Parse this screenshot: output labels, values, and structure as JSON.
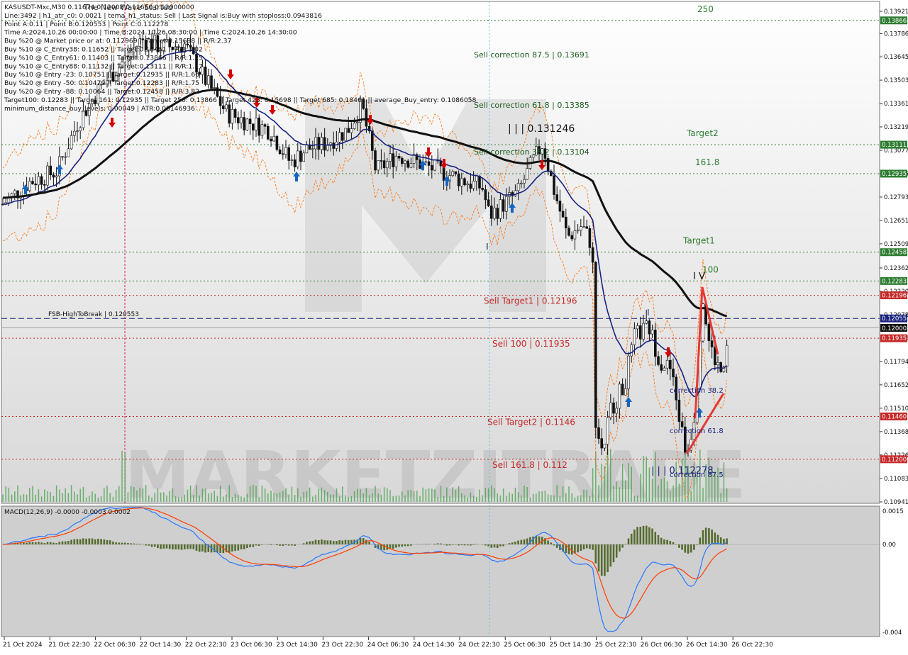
{
  "header": {
    "lines": [
      "KASUSDT-Mxc,M30  0.11674 0.12008 0.11660 0.12000000",
      "Line:3492 | h1_atr_c0: 0.0021 | tema_h1_status: Sell | Last Signal is:Buy with stoploss:0.0943816",
      "Point A:0.11 | Point B:0.120553 | Point C:0.112278",
      "Time A:2024.10.26 00:00:00 | Time B:2024.10.26 08:30:00 | Time C:2024.10.26 14:30:00",
      "Buy %20 @ Market price or at: 0.112969 || Target:0.15698 || R/R:2.37",
      "Buy %10 @ C_Entry38: 0.11652 || Target:0.18461 || R/R:3.02",
      "Buy %10 @ C_Entry61: 0.11403 || Target:0.13866 || R/R:1.25",
      "Buy %10 @ C_Entry88: 0.11132 || Target:0.13111 || R/R:1.17",
      "Buy %10 @ Entry -23: 0.10751 || Target:0.12935 || R/R:1.66",
      "Buy %20 @ Entry -50: 0.10479 || Target:0.12283 || R/R:1.75",
      "Buy %20 @ Entry -88: 0.10064 || Target:0.12458 || R/R:3.82",
      "Target100: 0.12283 || Target 161: 0.12935 || Target 250: 0.13866 || Target 423: 0.15698 || Target 685: 0.18461 || average_Buy_entry: 0.1086058",
      "minimum_distance_buy_levels: 0.00049 | ATR:0.00146936"
    ],
    "overlay_title": "The New Wave Started"
  },
  "chart_data": [
    {
      "type": "line",
      "title": "KASUSDT-Mxc,M30",
      "ylim": [
        0.10941,
        0.13921
      ],
      "price_ticks": [
        "0.13921",
        "0.13786",
        "0.13645",
        "0.13503",
        "0.13361",
        "0.13219",
        "0.13077",
        "0.12935",
        "0.12793",
        "0.12651",
        "0.12509",
        "0.12362",
        "0.12220",
        "0.12078",
        "0.11936",
        "0.11794",
        "0.11652",
        "0.11510",
        "0.11368",
        "0.11226",
        "0.11083",
        "0.10941"
      ],
      "x_ticks": [
        "21 Oct 2024",
        "21 Oct 22:30",
        "22 Oct 06:30",
        "22 Oct 14:30",
        "22 Oct 22:30",
        "23 Oct 06:30",
        "23 Oct 14:30",
        "23 Oct 22:30",
        "24 Oct 06:30",
        "24 Oct 14:30",
        "24 Oct 22:30",
        "25 Oct 06:30",
        "25 Oct 14:30",
        "25 Oct 22:30",
        "26 Oct 06:30",
        "26 Oct 14:30",
        "26 Oct 22:30"
      ],
      "levels": [
        {
          "label": "250",
          "value": 0.13866,
          "color": "#2e7d32",
          "badge": "0.13866"
        },
        {
          "label": "Target2",
          "value": 0.13111,
          "color": "#2e7d32",
          "badge": "0.13111"
        },
        {
          "label": "161.8",
          "value": 0.12935,
          "color": "#2e7d32",
          "badge": "0.12935"
        },
        {
          "label": "Target1",
          "value": 0.12458,
          "color": "#2e7d32",
          "badge": "0.12458"
        },
        {
          "label": "100",
          "value": 0.12283,
          "color": "#2e7d32",
          "badge": "0.12283"
        },
        {
          "label": "Sell Target1 | 0.12196",
          "value": 0.12196,
          "color": "#c62828",
          "badge": "0.12196"
        },
        {
          "label": "FSB-HighToBreak | 0.120553",
          "value": 0.120553,
          "color": "#1a237e",
          "badge": "0.12055"
        },
        {
          "label": "",
          "value": 0.12,
          "color": "#9e9e9e",
          "badge": "0.12000"
        },
        {
          "label": "Sell 100 | 0.11935",
          "value": 0.11935,
          "color": "#c62828",
          "badge": "0.11935"
        },
        {
          "label": "Sell Target2 | 0.1146",
          "value": 0.1146,
          "color": "#c62828",
          "badge": "0.11460"
        },
        {
          "label": "Sell 161.8 | 0.112",
          "value": 0.112,
          "color": "#c62828",
          "badge": "0.11200"
        }
      ],
      "annotations": [
        "Sell correction 87.5 | 0.13691",
        "Sell correction 61.8 | 0.13385",
        "Sell correction 38.2 | 0.13104",
        "| | | 0.131246",
        "I V",
        "I",
        "I",
        "| | | 0.112278",
        "correction 38.2",
        "correction 61.8",
        "correction 87.5"
      ],
      "series": [
        {
          "name": "close",
          "color": "#000000"
        },
        {
          "name": "",
          "color": "#1a237e"
        },
        {
          "name": "",
          "color": "#111111"
        },
        {
          "name": "",
          "color": "#ff6d00"
        },
        {
          "name": "",
          "color": "#e53935"
        }
      ],
      "watermark": "MARKETZITRADE"
    },
    {
      "type": "bar",
      "title": "MACD(12,26,9) -0.0000 -0.0003 0.0002",
      "ylim": [
        -0.004,
        0.0015
      ],
      "ticks": [
        "0.0015",
        "0.00",
        "-0.004"
      ],
      "series": [
        {
          "name": "histogram",
          "color": "#556b2f"
        },
        {
          "name": "",
          "color": "#2979ff"
        },
        {
          "name": "",
          "color": "#ff3d00"
        }
      ]
    }
  ],
  "colors": {
    "buy_arrow": "#1565c0",
    "sell_arrow": "#d50000",
    "bull": "#2e7d32",
    "bear": "#c62828"
  }
}
